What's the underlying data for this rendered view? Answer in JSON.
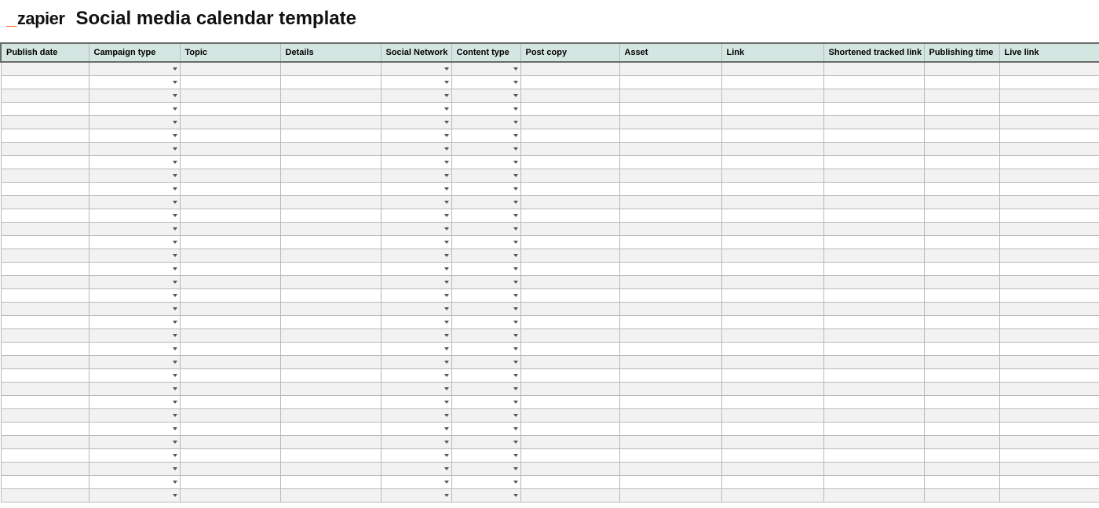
{
  "brand": {
    "name": "zapier"
  },
  "title": "Social media calendar template",
  "table": {
    "row_count": 33,
    "columns": [
      {
        "key": "publish_date",
        "label": "Publish date",
        "dropdown": false,
        "class": "c-publish"
      },
      {
        "key": "campaign_type",
        "label": "Campaign type",
        "dropdown": true,
        "class": "c-campaign"
      },
      {
        "key": "topic",
        "label": "Topic",
        "dropdown": false,
        "class": "c-topic"
      },
      {
        "key": "details",
        "label": "Details",
        "dropdown": false,
        "class": "c-details"
      },
      {
        "key": "social_network",
        "label": "Social Network",
        "dropdown": true,
        "class": "c-social"
      },
      {
        "key": "content_type",
        "label": "Content type",
        "dropdown": true,
        "class": "c-content"
      },
      {
        "key": "post_copy",
        "label": "Post copy",
        "dropdown": false,
        "class": "c-postcopy"
      },
      {
        "key": "asset",
        "label": "Asset",
        "dropdown": false,
        "class": "c-asset"
      },
      {
        "key": "link",
        "label": "Link",
        "dropdown": false,
        "class": "c-link"
      },
      {
        "key": "short_link",
        "label": "Shortened tracked link",
        "dropdown": false,
        "class": "c-shortlink"
      },
      {
        "key": "pub_time",
        "label": "Publishing time",
        "dropdown": false,
        "class": "c-pubtime"
      },
      {
        "key": "live_link",
        "label": "Live link",
        "dropdown": false,
        "class": "c-livelink"
      }
    ],
    "rows": []
  }
}
